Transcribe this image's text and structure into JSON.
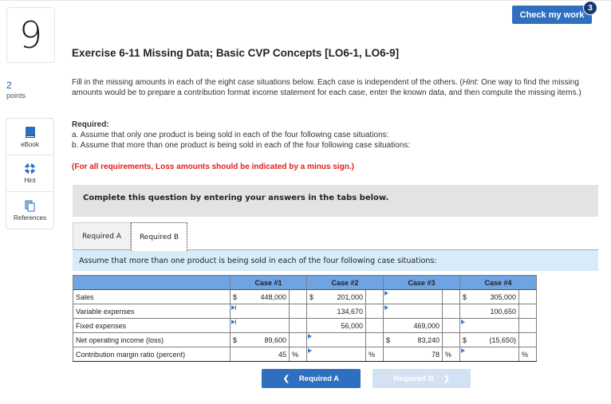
{
  "question": {
    "number": "9",
    "points_value": "2",
    "points_label": "points",
    "title": "Exercise 6-11 Missing Data; Basic CVP Concepts [LO6-1, LO6-9]",
    "instructions_pre": "Fill in the missing amounts in each of the eight case situations below. Each case is independent of the others. (",
    "instructions_hint_label": "Hint:",
    "instructions_post": " One way to find the missing amounts would be to prepare a contribution format income statement for each case, enter the known data, and then compute the missing items.)",
    "required_heading": "Required:",
    "required_a": "a. Assume that only one product is being sold in each of the four following case situations:",
    "required_b": "b. Assume that more than one product is being sold in each of the four following case situations:",
    "loss_note": "(For all requirements, Loss amounts should be indicated by a minus sign.)"
  },
  "header": {
    "check_button": "Check my work",
    "check_badge": "3"
  },
  "tools": [
    {
      "label": "eBook",
      "icon": "book-icon"
    },
    {
      "label": "Hint",
      "icon": "lifebuoy-icon"
    },
    {
      "label": "References",
      "icon": "documents-icon"
    }
  ],
  "colors": {
    "accent": "#2f6fc0",
    "table_header": "#6fa4e4",
    "loss_note": "#e0201b",
    "assume_bar": "#d7ebf8"
  },
  "panel": {
    "complete_text": "Complete this question by entering your answers in the tabs below.",
    "tabs": [
      {
        "label": "Required A",
        "active": false
      },
      {
        "label": "Required B",
        "active": true
      }
    ],
    "assume_text": "Assume that more than one product is being sold in each of the four following case situations:"
  },
  "table": {
    "headers": [
      "",
      "Case #1",
      "Case #2",
      "Case #3",
      "Case #4"
    ],
    "rows": [
      {
        "label": "Sales",
        "cases": [
          {
            "cur": "$",
            "value": "448,000",
            "pct": ""
          },
          {
            "cur": "$",
            "value": "201,000",
            "pct": ""
          },
          {
            "cur": "",
            "value": "",
            "pct": "",
            "input": true
          },
          {
            "cur": "$",
            "value": "305,000",
            "pct": ""
          }
        ]
      },
      {
        "label": "Variable expenses",
        "cases": [
          {
            "cur": "",
            "value": "",
            "pct": "",
            "input": true
          },
          {
            "cur": "",
            "value": "134,670",
            "pct": ""
          },
          {
            "cur": "",
            "value": "",
            "pct": "",
            "input": true
          },
          {
            "cur": "",
            "value": "100,650",
            "pct": ""
          }
        ]
      },
      {
        "label": "Fixed expenses",
        "cases": [
          {
            "cur": "",
            "value": "",
            "pct": "",
            "input": true
          },
          {
            "cur": "",
            "value": "56,000",
            "pct": ""
          },
          {
            "cur": "",
            "value": "469,000",
            "pct": ""
          },
          {
            "cur": "",
            "value": "",
            "pct": "",
            "input": true
          }
        ]
      },
      {
        "label": "Net operating income (loss)",
        "cases": [
          {
            "cur": "$",
            "value": "89,600",
            "pct": ""
          },
          {
            "cur": "",
            "value": "",
            "pct": "",
            "input": true
          },
          {
            "cur": "$",
            "value": "83,240",
            "pct": ""
          },
          {
            "cur": "$",
            "value": "(15,650)",
            "pct": ""
          }
        ]
      },
      {
        "label": "Contribution margin ratio (percent)",
        "cases": [
          {
            "cur": "",
            "value": "45",
            "pct": "%"
          },
          {
            "cur": "",
            "value": "",
            "pct": "%",
            "input": true
          },
          {
            "cur": "",
            "value": "78",
            "pct": "%"
          },
          {
            "cur": "",
            "value": "",
            "pct": "%",
            "input": true
          }
        ]
      }
    ]
  },
  "nav": {
    "prev_label": "Required A",
    "next_label": "Required B"
  }
}
